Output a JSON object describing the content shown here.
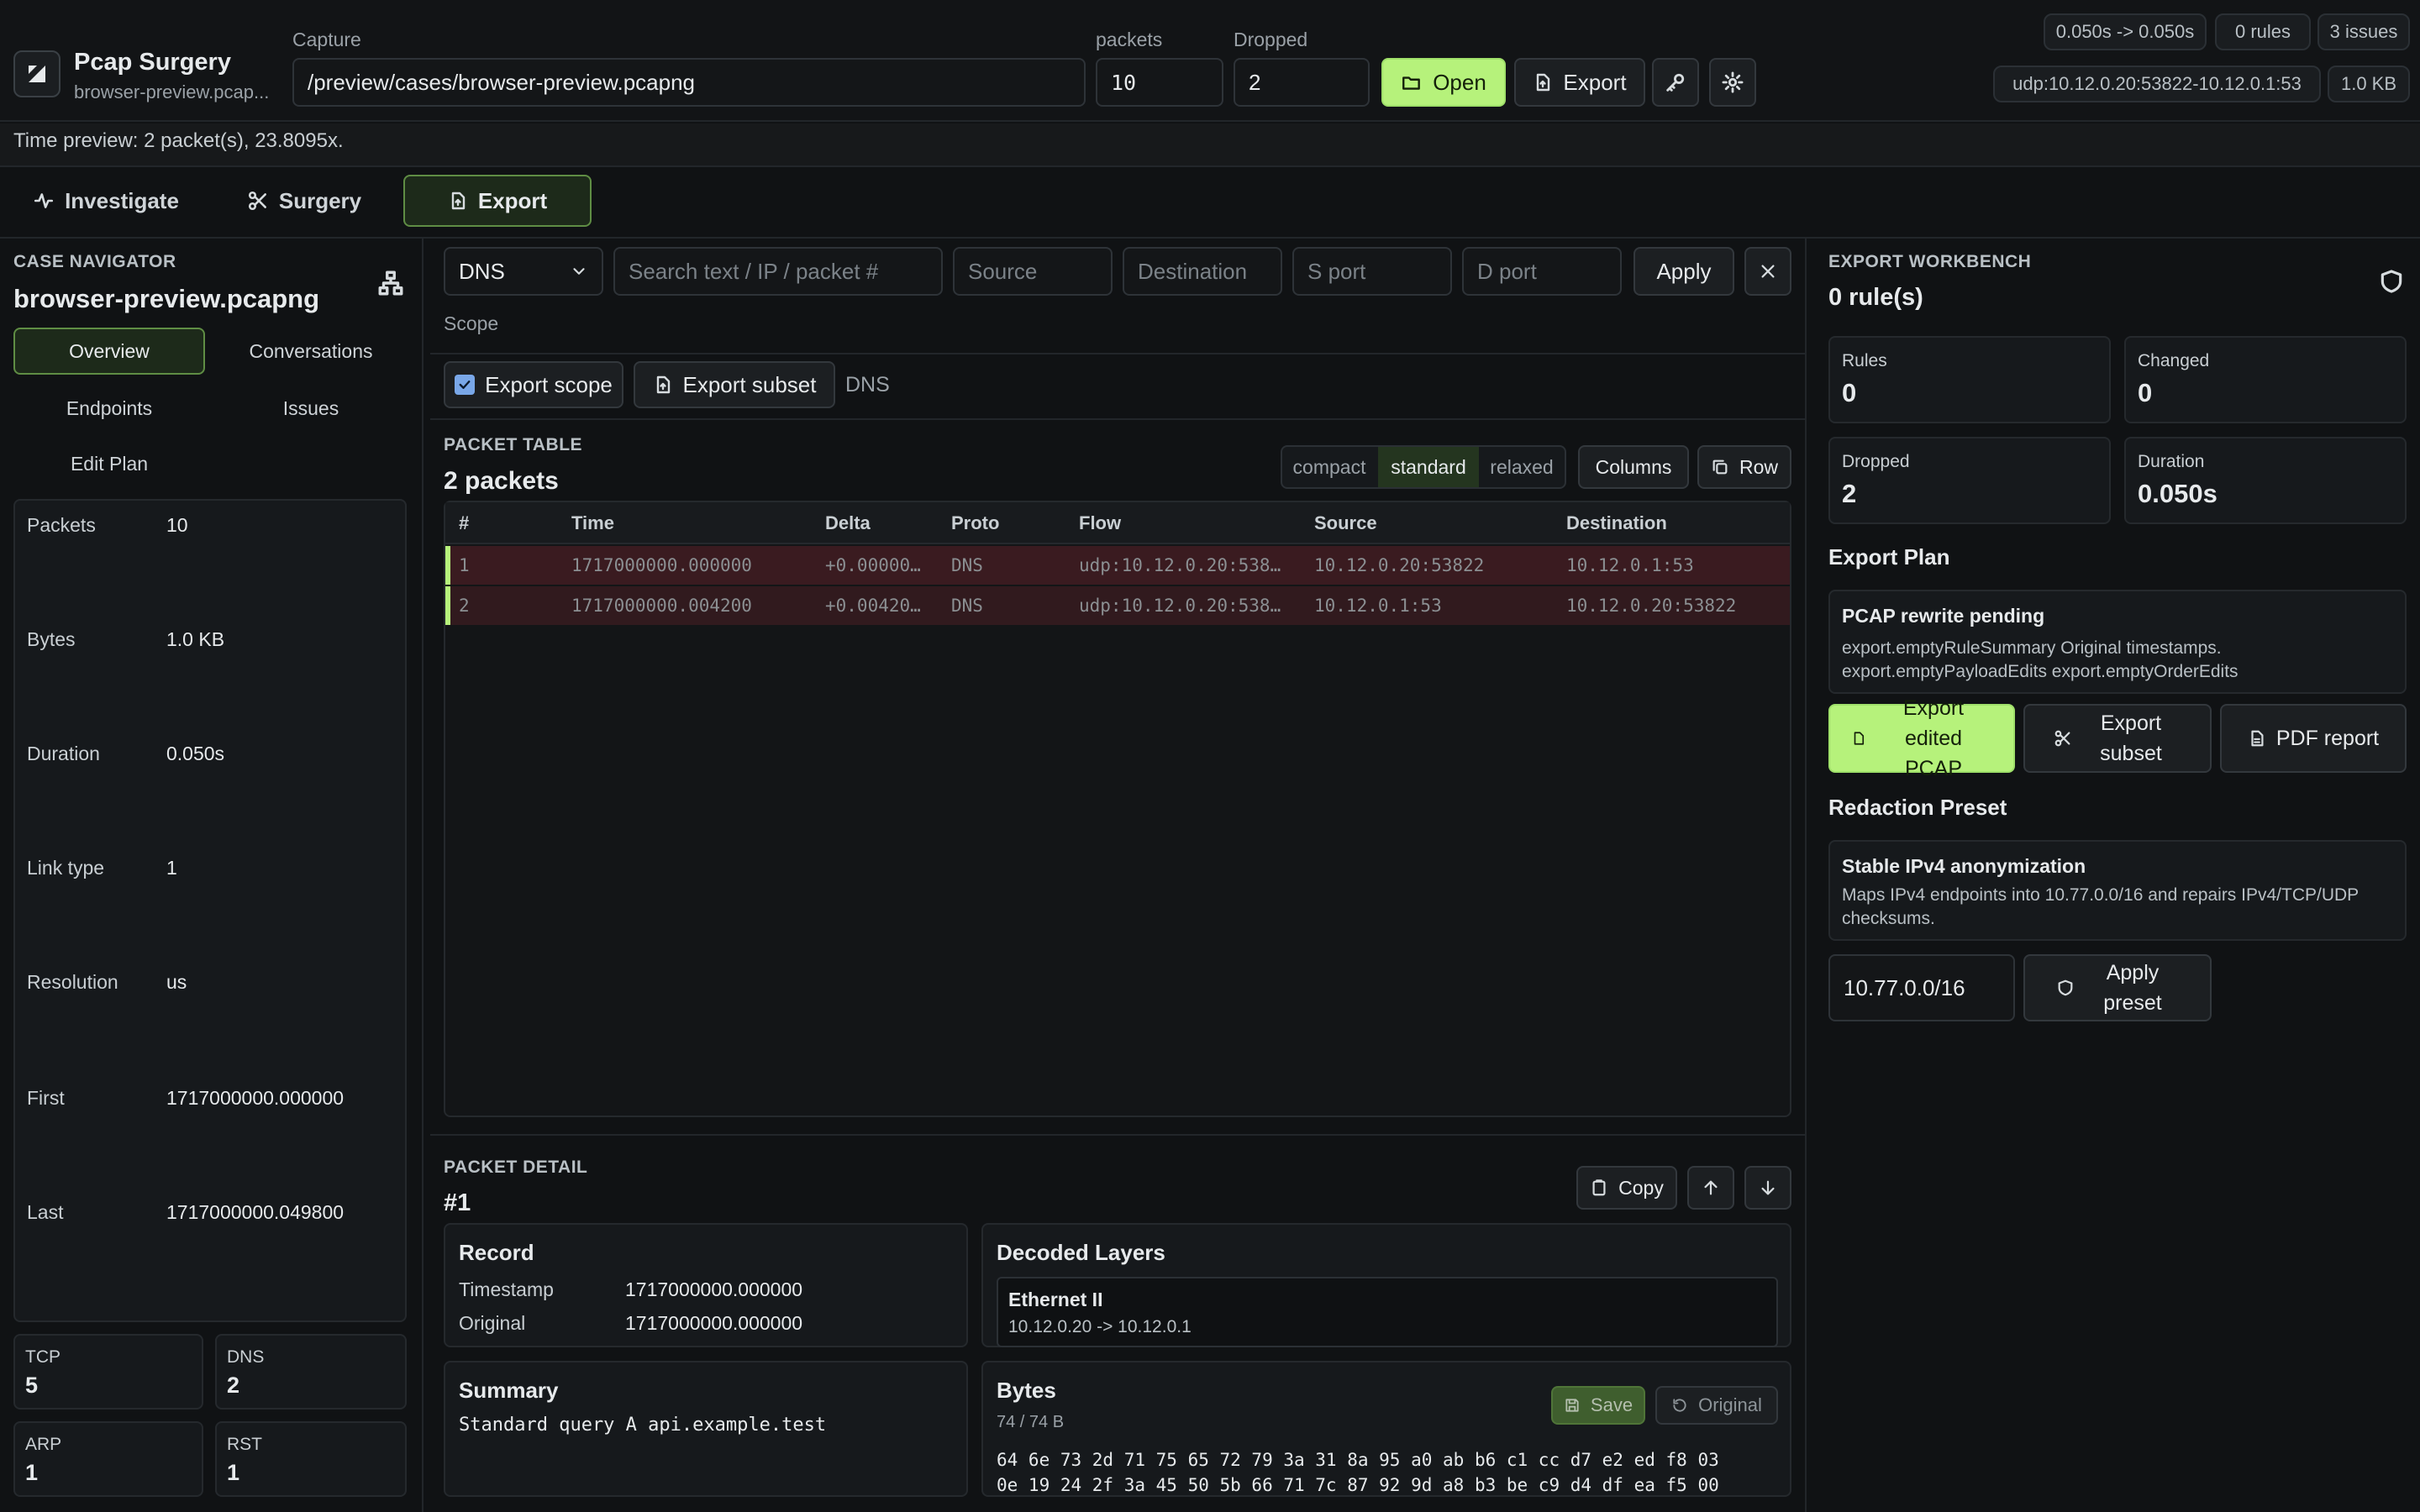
{
  "app": {
    "title": "Pcap Surgery",
    "subtitle": "browser-preview.pcap..."
  },
  "toolbar": {
    "capture_label": "Capture",
    "capture_value": "/preview/cases/browser-preview.pcapng",
    "packets_label": "packets",
    "packets_value": "10",
    "dropped_label": "Dropped",
    "dropped_value": "2",
    "open_label": "Open",
    "export_label": "Export"
  },
  "status": {
    "time_range": "0.050s -> 0.050s",
    "rules": "0 rules",
    "issues": "3 issues",
    "flow": "udp:10.12.0.20:53822-10.12.0.1:53",
    "size": "1.0 KB",
    "time_preview": "Time preview: 2 packet(s), 23.8095x."
  },
  "tabs": [
    {
      "label": "Investigate"
    },
    {
      "label": "Surgery"
    },
    {
      "label": "Export"
    }
  ],
  "navigator": {
    "section": "CASE NAVIGATOR",
    "file": "browser-preview.pcapng",
    "tabs": [
      "Overview",
      "Conversations",
      "Endpoints",
      "Issues",
      "Edit Plan"
    ],
    "stats": [
      {
        "label": "Packets",
        "value": "10"
      },
      {
        "label": "Bytes",
        "value": "1.0 KB"
      },
      {
        "label": "Duration",
        "value": "0.050s"
      },
      {
        "label": "Link type",
        "value": "1"
      },
      {
        "label": "Resolution",
        "value": "us"
      },
      {
        "label": "First",
        "value": "1717000000.000000"
      },
      {
        "label": "Last",
        "value": "1717000000.049800"
      }
    ],
    "protocols": [
      {
        "label": "TCP",
        "value": "5"
      },
      {
        "label": "DNS",
        "value": "2"
      },
      {
        "label": "ARP",
        "value": "1"
      },
      {
        "label": "RST",
        "value": "1"
      }
    ]
  },
  "filter": {
    "protocol": "DNS",
    "search_placeholder": "Search text / IP / packet #",
    "source_placeholder": "Source",
    "destination_placeholder": "Destination",
    "sport_placeholder": "S port",
    "dport_placeholder": "D port",
    "apply_label": "Apply",
    "scope_label": "Scope",
    "export_scope_label": "Export scope",
    "export_subset_label": "Export subset",
    "scope_tag": "DNS"
  },
  "packet_table": {
    "section": "PACKET TABLE",
    "count": "2 packets",
    "density": [
      "compact",
      "standard",
      "relaxed"
    ],
    "columns_label": "Columns",
    "row_label": "Row",
    "headers": [
      "#",
      "Time",
      "Delta",
      "Proto",
      "Flow",
      "Source",
      "Destination"
    ],
    "rows": [
      [
        "1",
        "1717000000.000000",
        "+0.00000…",
        "DNS",
        "udp:10.12.0.20:538…",
        "10.12.0.20:53822",
        "10.12.0.1:53"
      ],
      [
        "2",
        "1717000000.004200",
        "+0.00420…",
        "DNS",
        "udp:10.12.0.20:538…",
        "10.12.0.1:53",
        "10.12.0.20:53822"
      ]
    ]
  },
  "packet_detail": {
    "section": "PACKET DETAIL",
    "id": "#1",
    "copy_label": "Copy",
    "record_title": "Record",
    "timestamp_label": "Timestamp",
    "timestamp_value": "1717000000.000000",
    "original_label": "Original",
    "original_value": "1717000000.000000",
    "decoded_title": "Decoded Layers",
    "layer_name": "Ethernet II",
    "layer_detail": "10.12.0.20 -> 10.12.0.1",
    "summary_title": "Summary",
    "summary_value": "Standard query A api.example.test",
    "bytes_title": "Bytes",
    "bytes_count": "74 / 74 B",
    "save_label": "Save",
    "original_btn_label": "Original",
    "hex_line1": "64 6e 73 2d 71 75 65 72 79 3a 31 8a 95 a0 ab b6 c1 cc d7 e2 ed f8 03",
    "hex_line2": "0e 19 24 2f 3a 45 50 5b 66 71 7c 87 92 9d a8 b3 be c9 d4 df ea f5 00"
  },
  "workbench": {
    "section": "EXPORT WORKBENCH",
    "rules_count": "0 rule(s)",
    "metrics": [
      {
        "label": "Rules",
        "value": "0"
      },
      {
        "label": "Changed",
        "value": "0"
      },
      {
        "label": "Dropped",
        "value": "2"
      },
      {
        "label": "Duration",
        "value": "0.050s"
      }
    ],
    "plan_title": "Export Plan",
    "plan_card_title": "PCAP rewrite pending",
    "plan_card_body": "export.emptyRuleSummary Original timestamps. export.emptyPayloadEdits export.emptyOrderEdits",
    "export_pcap_label": "Export edited PCAP",
    "export_subset_label": "Export subset",
    "pdf_label": "PDF report",
    "redaction_title": "Redaction Preset",
    "redaction_card_title": "Stable IPv4 anonymization",
    "redaction_card_body": "Maps IPv4 endpoints into 10.77.0.0/16 and repairs IPv4/TCP/UDP checksums.",
    "subnet_value": "10.77.0.0/16",
    "apply_preset_label": "Apply preset"
  },
  "colors": {
    "accent": "#b6f27b",
    "background": "#101214",
    "dropped_row": "#3a1b20"
  }
}
